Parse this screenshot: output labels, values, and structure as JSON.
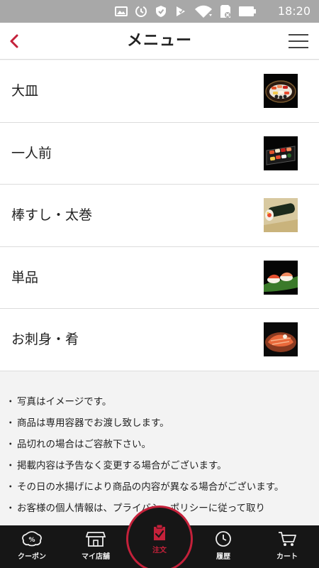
{
  "status_bar": {
    "time": "18:20"
  },
  "header": {
    "title": "メニュー"
  },
  "menu": [
    {
      "label": "大皿",
      "image": "sushi-platter-round"
    },
    {
      "label": "一人前",
      "image": "sushi-single-set"
    },
    {
      "label": "棒すし・太巻",
      "image": "sushi-roll"
    },
    {
      "label": "単品",
      "image": "nigiri-single"
    },
    {
      "label": "お刺身・肴",
      "image": "sashimi-plate"
    }
  ],
  "notes": [
    "写真はイメージです。",
    "商品は専用容器でお渡し致します。",
    "品切れの場合はご容赦下さい。",
    "掲載内容は予告なく変更する場合がございます。",
    "その日の水揚げにより商品の内容が異なる場合がございます。",
    "お客様の個人情報は、プライバシーポリシーに従って取り"
  ],
  "bottom_nav": {
    "coupon": "クーポン",
    "my_store": "マイ店舗",
    "order": "注文",
    "history": "履歴",
    "cart": "カート"
  },
  "colors": {
    "accent": "#c4213a",
    "nav_bg": "#161616",
    "status_bg": "#a8a8a8"
  }
}
